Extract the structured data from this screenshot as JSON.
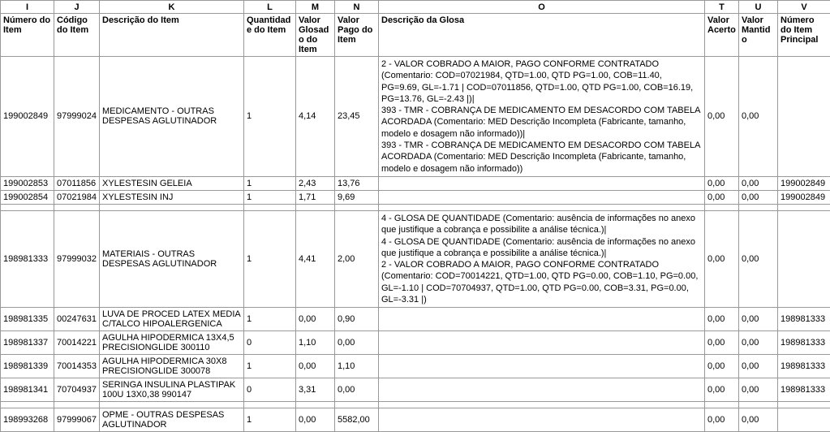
{
  "columns": {
    "letters": [
      "I",
      "J",
      "K",
      "L",
      "M",
      "N",
      "O",
      "T",
      "U",
      "V"
    ],
    "headers": [
      "Número do Item",
      "Código do Item",
      "Descrição do Item",
      "Quantidade do Item",
      "Valor Glosado do Item",
      "Valor Pago do Item",
      "Descrição da Glosa",
      "Valor Acerto",
      "Valor Mantido",
      "Número do Item Principal"
    ]
  },
  "rows": [
    {
      "i": "199002849",
      "j": "97999024",
      "k": "MEDICAMENTO - OUTRAS DESPESAS AGLUTINADOR",
      "l": "1",
      "m": "4,14",
      "n": "23,45",
      "o": "2 - VALOR COBRADO A MAIOR, PAGO CONFORME CONTRATADO (Comentario: COD=07021984, QTD=1.00, QTD PG=1.00, COB=11.40, PG=9.69, GL=-1.71 | COD=07011856, QTD=1.00, QTD PG=1.00, COB=16.19, PG=13.76, GL=-2.43 |)|\n393 - TMR - COBRANÇA DE MEDICAMENTO EM DESACORDO COM TABELA ACORDADA (Comentario: MED Descrição Incompleta (Fabricante, tamanho, modelo e dosagem não informado))|\n393 - TMR - COBRANÇA DE MEDICAMENTO EM DESACORDO COM TABELA ACORDADA (Comentario: MED Descrição Incompleta (Fabricante, tamanho, modelo e dosagem não informado))",
      "t": "0,00",
      "u": "0,00",
      "v": ""
    },
    {
      "i": "199002853",
      "j": "07011856",
      "k": "XYLESTESIN GELEIA",
      "l": "1",
      "m": "2,43",
      "n": "13,76",
      "o": "",
      "t": "0,00",
      "u": "0,00",
      "v": "199002849"
    },
    {
      "i": "199002854",
      "j": "07021984",
      "k": "XYLESTESIN INJ",
      "l": "1",
      "m": "1,71",
      "n": "9,69",
      "o": "",
      "t": "0,00",
      "u": "0,00",
      "v": "199002849"
    },
    {
      "blank": true
    },
    {
      "i": "198981333",
      "j": "97999032",
      "k": "MATERIAIS - OUTRAS DESPESAS AGLUTINADOR",
      "l": "1",
      "m": "4,41",
      "n": "2,00",
      "o": "4 - GLOSA DE QUANTIDADE (Comentario: ausência de informações no anexo que justifique a cobrança e possibilite a análise técnica.)|\n4 - GLOSA DE QUANTIDADE (Comentario: ausência de informações no anexo que justifique a cobrança e possibilite a análise técnica.)|\n2 - VALOR COBRADO A MAIOR, PAGO CONFORME CONTRATADO (Comentario: COD=70014221, QTD=1.00, QTD PG=0.00, COB=1.10, PG=0.00, GL=-1.10 | COD=70704937, QTD=1.00, QTD PG=0.00, COB=3.31, PG=0.00, GL=-3.31 |)",
      "t": "0,00",
      "u": "0,00",
      "v": ""
    },
    {
      "i": "198981335",
      "j": "00247631",
      "k": "LUVA DE PROCED LATEX MEDIA C/TALCO HIPOALERGENICA",
      "l": "1",
      "m": "0,00",
      "n": "0,90",
      "o": "",
      "t": "0,00",
      "u": "0,00",
      "v": "198981333"
    },
    {
      "i": "198981337",
      "j": "70014221",
      "k": "AGULHA HIPODERMICA 13X4,5 PRECISIONGLIDE 300110",
      "l": "0",
      "m": "1,10",
      "n": "0,00",
      "o": "",
      "t": "0,00",
      "u": "0,00",
      "v": "198981333"
    },
    {
      "i": "198981339",
      "j": "70014353",
      "k": "AGULHA HIPODERMICA 30X8 PRECISIONGLIDE 300078",
      "l": "1",
      "m": "0,00",
      "n": "1,10",
      "o": "",
      "t": "0,00",
      "u": "0,00",
      "v": "198981333"
    },
    {
      "i": "198981341",
      "j": "70704937",
      "k": "SERINGA INSULINA PLASTIPAK 100U 13X0,38 990147",
      "l": "0",
      "m": "3,31",
      "n": "0,00",
      "o": "",
      "t": "0,00",
      "u": "0,00",
      "v": "198981333"
    },
    {
      "blank": true
    },
    {
      "i": "198993268",
      "j": "97999067",
      "k": "OPME - OUTRAS DESPESAS AGLUTINADOR",
      "l": "1",
      "m": "0,00",
      "n": "5582,00",
      "o": "",
      "t": "0,00",
      "u": "0,00",
      "v": ""
    }
  ]
}
